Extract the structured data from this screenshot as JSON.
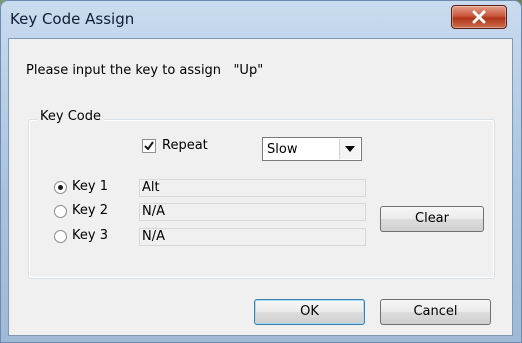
{
  "window": {
    "title": "Key Code Assign"
  },
  "prompt": {
    "label": "Please input the key to assign",
    "key_name": "\"Up\""
  },
  "group": {
    "legend": "Key Code"
  },
  "repeat": {
    "label": "Repeat",
    "checked": true
  },
  "speed": {
    "selected": "Slow"
  },
  "keys": [
    {
      "label": "Key 1",
      "value": "Alt",
      "selected": true
    },
    {
      "label": "Key 2",
      "value": "N/A",
      "selected": false
    },
    {
      "label": "Key 3",
      "value": "N/A",
      "selected": false
    }
  ],
  "buttons": {
    "clear": "Clear",
    "ok": "OK",
    "cancel": "Cancel"
  },
  "icons": {
    "close": "close-icon",
    "check": "checkmark-icon",
    "dropdown": "chevron-down-icon"
  },
  "colors": {
    "close_button": "#c9573d",
    "default_button_border": "#3c7fb1"
  }
}
